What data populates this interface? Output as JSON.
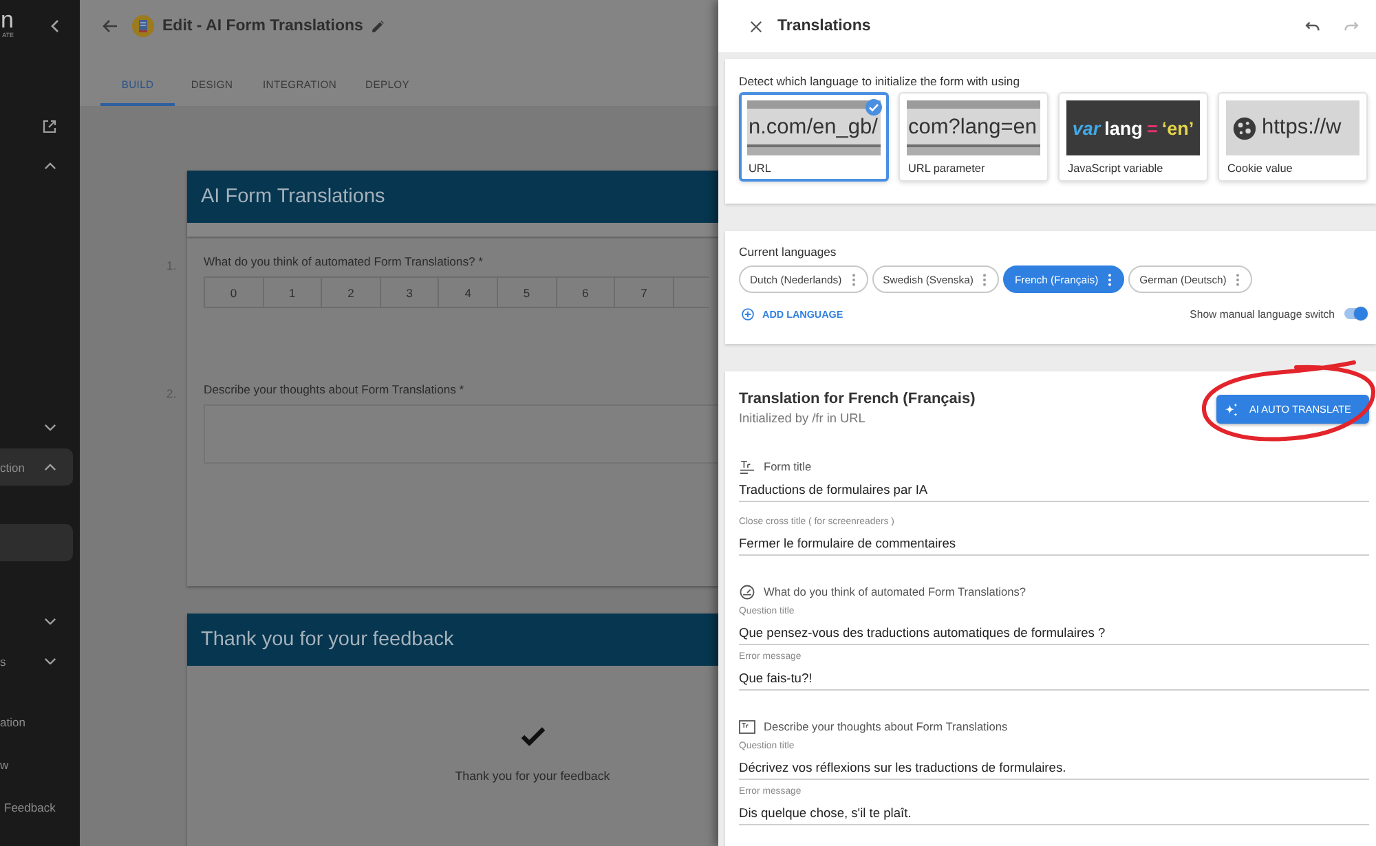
{
  "sidebar": {
    "logo": {
      "text": "n",
      "tagline": "ATE"
    },
    "items": [
      {
        "kind": "external",
        "selected": false
      },
      {
        "kind": "group",
        "expanded": true,
        "selected": false
      },
      {
        "kind": "group",
        "expanded": false,
        "selected": false
      },
      {
        "kind": "group",
        "label": "ction",
        "expanded": true,
        "selected": true
      },
      {
        "kind": "link",
        "selected": true
      },
      {
        "kind": "group",
        "expanded": false,
        "selected": false
      },
      {
        "kind": "group",
        "label": "s",
        "expanded": false,
        "selected": false
      },
      {
        "kind": "link",
        "label": "ation",
        "selected": false
      },
      {
        "kind": "link",
        "label": "w",
        "selected": false
      },
      {
        "kind": "link",
        "label": "Feedback",
        "selected": false
      }
    ]
  },
  "header": {
    "title": "Edit - AI Form Translations",
    "tabs": [
      {
        "label": "BUILD",
        "selected": true
      },
      {
        "label": "DESIGN",
        "selected": false
      },
      {
        "label": "INTEGRATION",
        "selected": false
      },
      {
        "label": "DEPLOY",
        "selected": false
      }
    ]
  },
  "form": {
    "cards": [
      {
        "kind": "questions",
        "title": "AI Form Translations",
        "questions": [
          {
            "number": "1.",
            "label": "What do you think of automated Form Translations? *",
            "kind": "scale",
            "options": [
              "0",
              "1",
              "2",
              "3",
              "4",
              "5",
              "6",
              "7"
            ]
          },
          {
            "number": "2.",
            "label": "Describe your thoughts about Form Translations *",
            "kind": "textarea"
          }
        ]
      },
      {
        "kind": "thanks",
        "title": "Thank you for your feedback",
        "message": "Thank you for your feedback"
      }
    ]
  },
  "drawer": {
    "title": "Translations",
    "actions": [
      {
        "kind": "undo",
        "disabled": false
      },
      {
        "kind": "redo",
        "disabled": true
      }
    ],
    "detect": {
      "label": "Detect which language to initialize the form with using",
      "options": [
        {
          "label": "URL",
          "selected": true,
          "preview": {
            "kind": "url",
            "text": "n.com/en_gb/"
          }
        },
        {
          "label": "URL parameter",
          "selected": false,
          "preview": {
            "kind": "url",
            "text": "com?lang=en"
          }
        },
        {
          "label": "JavaScript variable",
          "selected": false,
          "preview": {
            "kind": "code",
            "tokens": [
              {
                "kind": "keyword",
                "text": "var"
              },
              {
                "kind": "name",
                "text": "lang"
              },
              {
                "kind": "operator",
                "text": "="
              },
              {
                "kind": "string",
                "text": "‘en’"
              }
            ]
          }
        },
        {
          "label": "Cookie value",
          "selected": false,
          "preview": {
            "kind": "cookie",
            "text": "https://w"
          }
        }
      ]
    },
    "languages": {
      "label": "Current languages",
      "items": [
        {
          "label": "Dutch (Nederlands)",
          "selected": false
        },
        {
          "label": "Swedish (Svenska)",
          "selected": false
        },
        {
          "label": "French (Français)",
          "selected": true
        },
        {
          "label": "German (Deutsch)",
          "selected": false
        }
      ],
      "add_label": "ADD LANGUAGE",
      "switch": {
        "label": "Show manual language switch",
        "on": true
      }
    },
    "translation": {
      "title": "Translation for French (Français)",
      "subtitle": "Initialized by /fr in URL",
      "button": {
        "label": "AI AUTO TRANSLATE",
        "circled": true
      },
      "sections": [
        {
          "kind": "title",
          "heading": "Form title",
          "fields": [
            {
              "value": "Traductions de formulaires par IA"
            },
            {
              "label": "Close cross title ( for screenreaders )",
              "value": "Fermer le formulaire de commentaires"
            }
          ]
        },
        {
          "kind": "scale",
          "heading": "What do you think of automated Form Translations?",
          "fields": [
            {
              "label": "Question title",
              "value": "Que pensez-vous des traductions automatiques de formulaires ?"
            },
            {
              "label": "Error message",
              "value": "Que fais-tu?!"
            }
          ]
        },
        {
          "kind": "text",
          "heading": "Describe your thoughts about Form Translations",
          "fields": [
            {
              "label": "Question title",
              "value": "Décrivez vos réflexions sur les traductions de formulaires."
            },
            {
              "label": "Error message",
              "value": "Dis quelque chose, s'il te plaît."
            }
          ]
        }
      ]
    }
  }
}
